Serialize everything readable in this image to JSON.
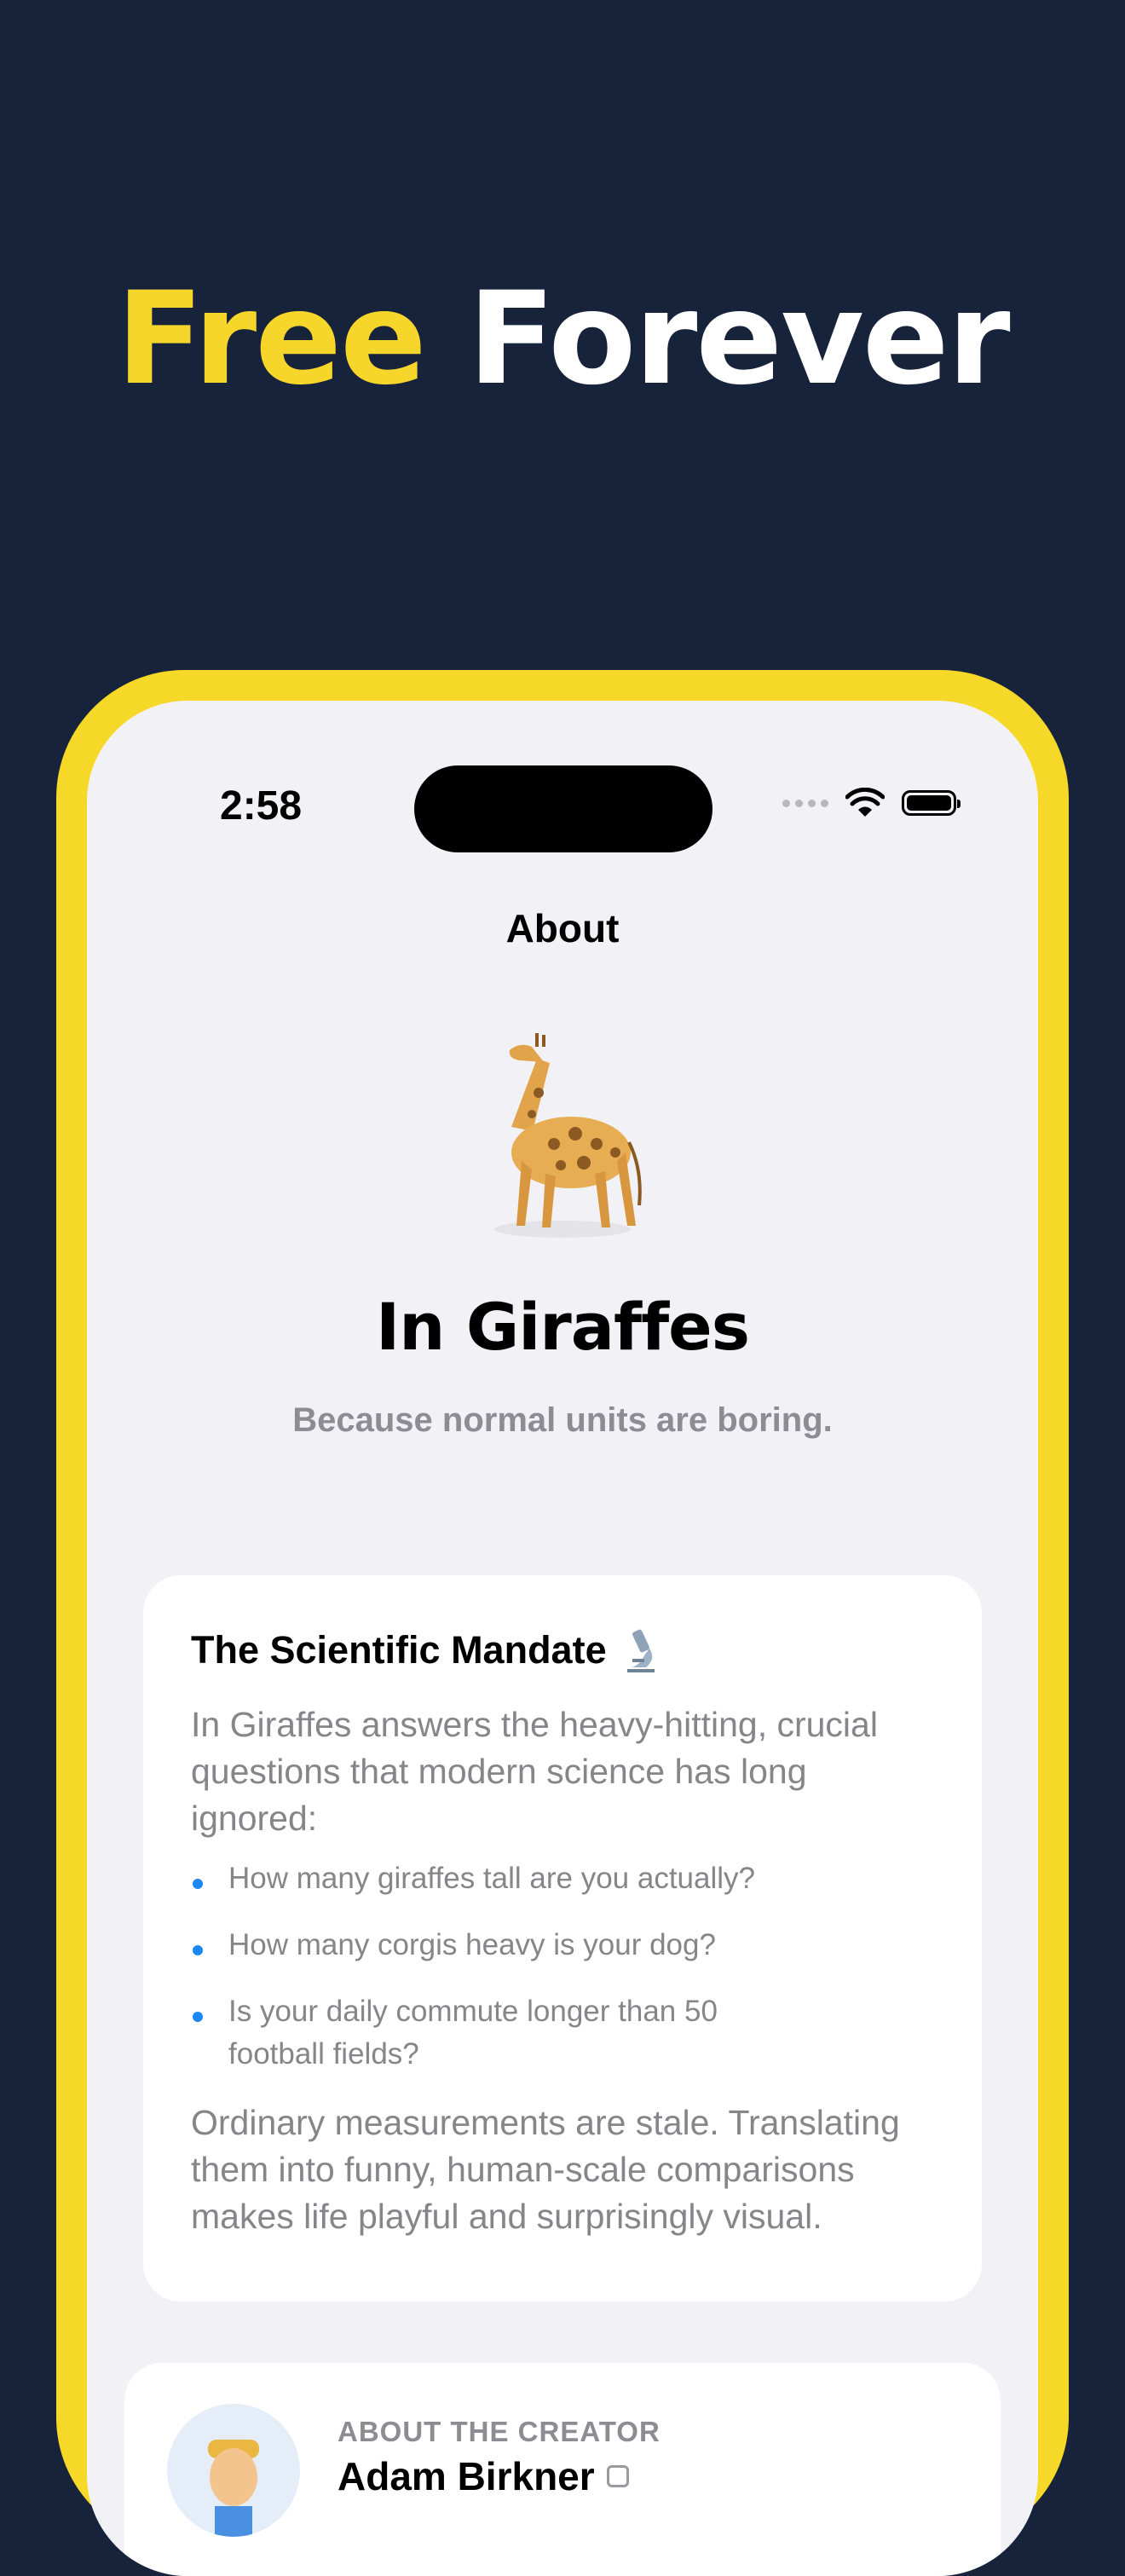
{
  "headline": {
    "word1": "Free",
    "word2": "Forever",
    "accent_color": "#f7d62c"
  },
  "status_bar": {
    "time": "2:58"
  },
  "nav": {
    "title": "About"
  },
  "hero": {
    "icon": "giraffe-icon",
    "app_name": "In Giraffes",
    "tagline": "Because normal units are boring."
  },
  "mandate_card": {
    "title": "The Scientific Mandate",
    "title_icon": "microscope-icon",
    "intro": "In Giraffes answers the heavy-hitting, crucial questions that modern science has long ignored:",
    "bullets": [
      "How many giraffes tall are you actually?",
      "How many corgis heavy is your dog?",
      "Is your daily commute longer than 50 football fields?"
    ],
    "outro": "Ordinary measurements are stale. Translating them into funny, human-scale comparisons makes life playful and surprisingly visual."
  },
  "creator_card": {
    "label": "ABOUT THE CREATOR",
    "name": "Adam Birkner",
    "link_icon": "external-link-icon"
  },
  "colors": {
    "background": "#17223b",
    "frame": "#f6d928",
    "bullet": "#1c86f2"
  }
}
